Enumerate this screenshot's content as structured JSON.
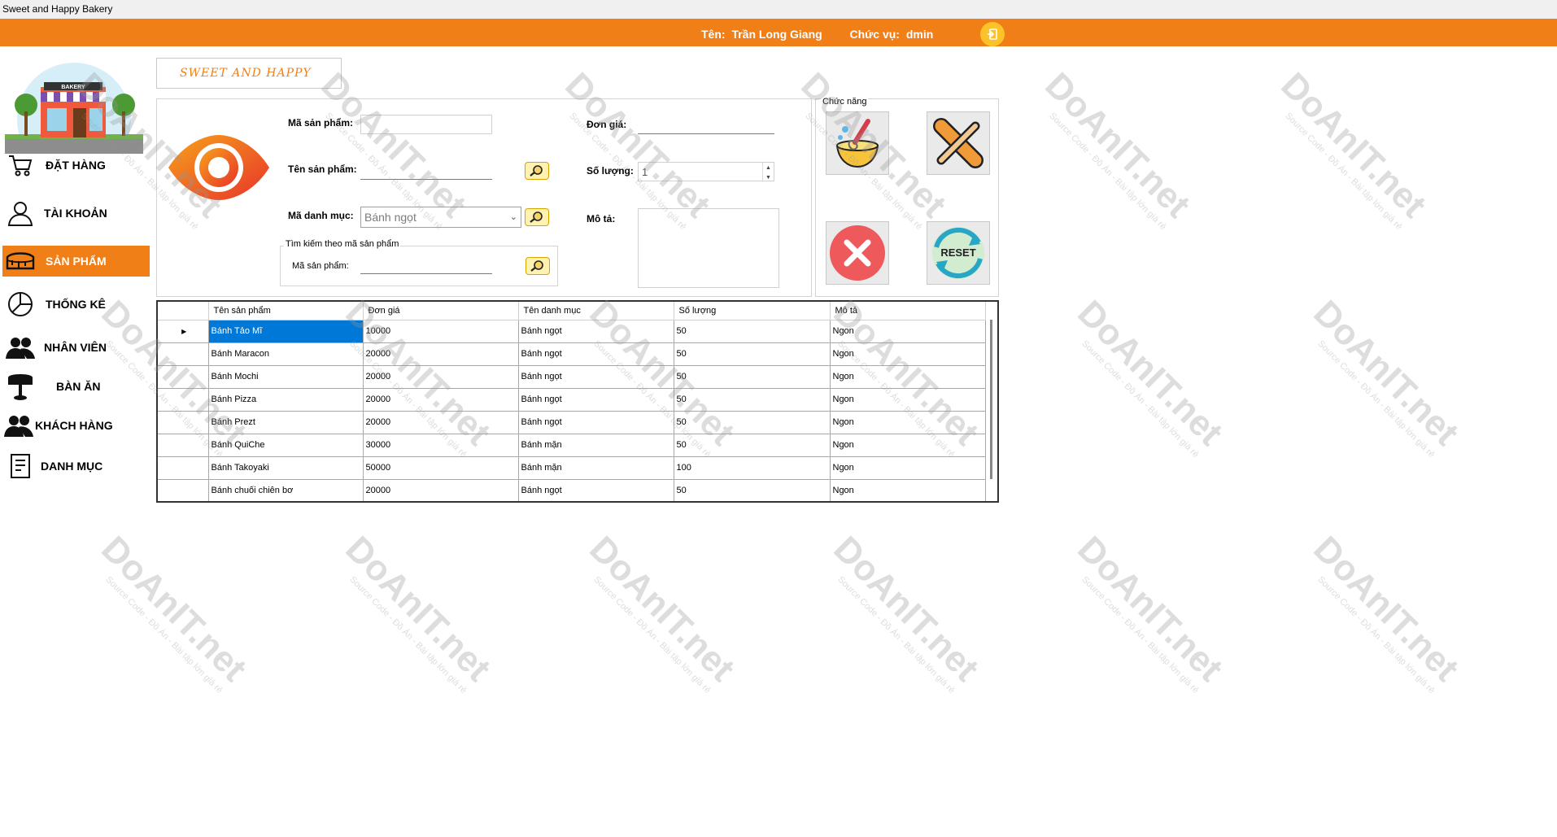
{
  "window": {
    "title": "Sweet and Happy Bakery"
  },
  "header": {
    "name_label": "Tên:",
    "name_value": "Trần Long Giang",
    "role_label": "Chức vụ:",
    "role_value": "dmin"
  },
  "sidebar": {
    "items": [
      {
        "label": "ĐẶT HÀNG",
        "icon": "cart-icon"
      },
      {
        "label": "TÀI KHOẢN",
        "icon": "user-icon"
      },
      {
        "label": "SẢN PHẨM",
        "icon": "cake-icon"
      },
      {
        "label": "THỐNG KÊ",
        "icon": "pie-chart-icon"
      },
      {
        "label": "NHÂN VIÊN",
        "icon": "staff-icon"
      },
      {
        "label": "BÀN ĂN",
        "icon": "table-icon"
      },
      {
        "label": "KHÁCH HÀNG",
        "icon": "customers-icon"
      },
      {
        "label": "DANH MỤC",
        "icon": "list-icon"
      }
    ]
  },
  "brand": {
    "text": "SWEET AND HAPPY"
  },
  "form": {
    "product_id_label": "Mã sản phẩm:",
    "product_id_value": "",
    "product_name_label": "Tên sản phẩm:",
    "product_name_value": "",
    "category_id_label": "Mã danh mục:",
    "category_id_value": "Bánh ngọt",
    "search_group_title": "Tìm kiếm theo mã sản phẩm",
    "search_product_id_label": "Mã sản phẩm:",
    "search_product_id_value": "",
    "price_label": "Đơn giá:",
    "price_value": "",
    "quantity_label": "Số lượng:",
    "quantity_value": "1",
    "description_label": "Mô tả:",
    "description_value": ""
  },
  "functions": {
    "title": "Chức năng",
    "reset_label": "RESET"
  },
  "grid": {
    "columns": [
      "Tên sản phẩm",
      "Đơn giá",
      "Tên danh mục",
      "Số lượng",
      "Mô tả"
    ],
    "rows": [
      [
        "Bánh Tảo Mĩ",
        "10000",
        "Bánh ngọt",
        "50",
        "Ngon"
      ],
      [
        "Bánh Maracon",
        "20000",
        "Bánh ngọt",
        "50",
        "Ngon"
      ],
      [
        "Bánh Mochi",
        "20000",
        "Bánh ngọt",
        "50",
        "Ngon"
      ],
      [
        "Bánh Pizza",
        "20000",
        "Bánh ngọt",
        "50",
        "Ngon"
      ],
      [
        "Bánh Prezt",
        "20000",
        "Bánh ngọt",
        "50",
        "Ngon"
      ],
      [
        "Bánh QuiChe",
        "30000",
        "Bánh mặn",
        "50",
        "Ngon"
      ],
      [
        "Bánh Takoyaki",
        "50000",
        "Bánh mặn",
        "100",
        "Ngon"
      ],
      [
        "Bánh chuối chiên bơ",
        "20000",
        "Bánh ngọt",
        "50",
        "Ngon"
      ]
    ]
  },
  "watermark": {
    "text": "DoAnIT.net",
    "subtext": "Source Code - Đồ Án - Bài tập lớn giá rẻ"
  },
  "logo": {
    "sign_text": "BAKERY"
  }
}
